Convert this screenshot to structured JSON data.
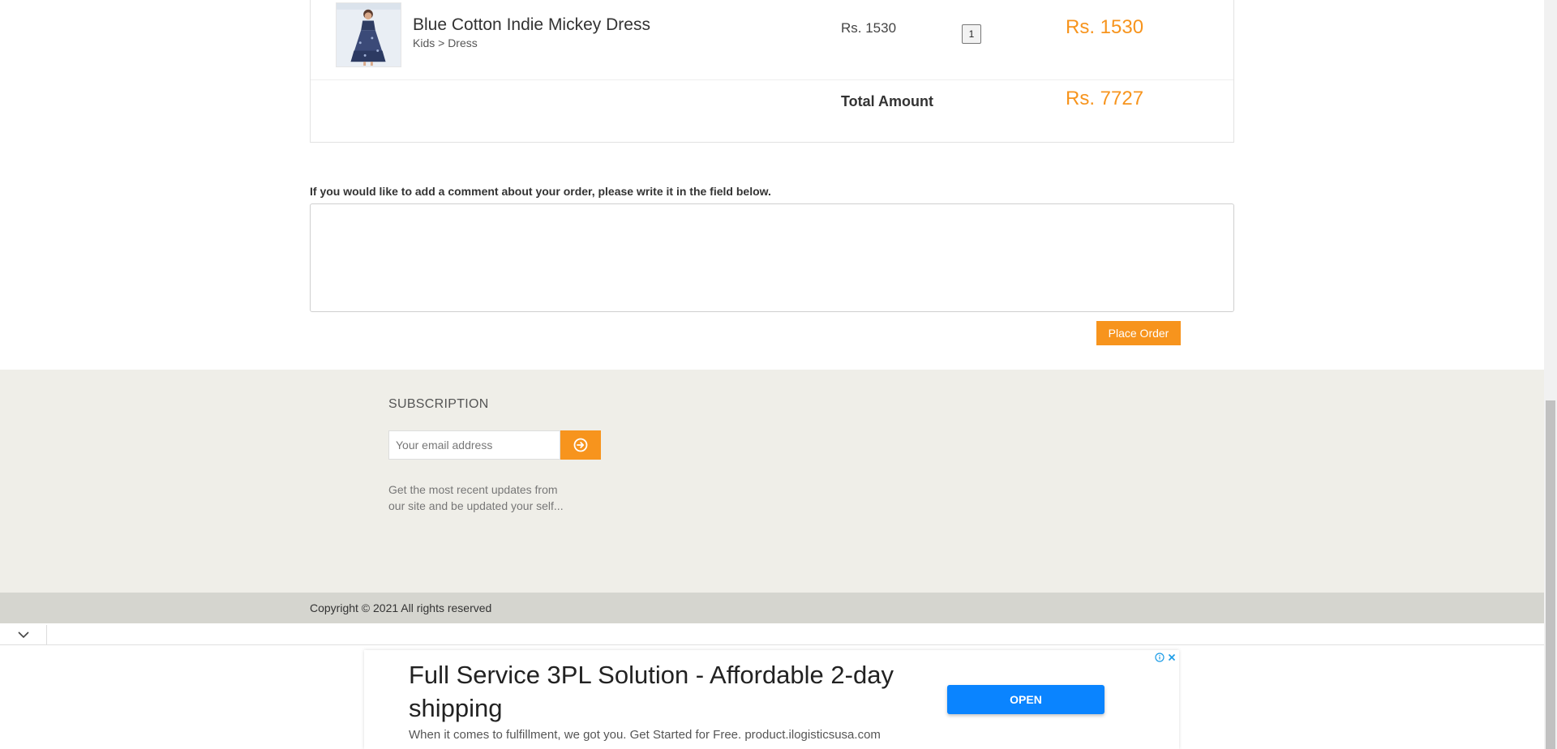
{
  "cart": {
    "item": {
      "name": "Blue Cotton Indie Mickey Dress",
      "category": "Kids > Dress",
      "unit_price": "Rs. 1530",
      "quantity": "1",
      "line_total": "Rs. 1530"
    },
    "total_label": "Total Amount",
    "total_value": "Rs. 7727"
  },
  "comment": {
    "label": "If you would like to add a comment about your order, please write it in the field below.",
    "value": "",
    "place_order_label": "Place Order"
  },
  "footer": {
    "subscription_title": "SUBSCRIPTION",
    "email_placeholder": "Your email address",
    "subscription_text": "Get the most recent updates from our site and be updated your self...",
    "copyright": "Copyright © 2021 All rights reserved"
  },
  "ad": {
    "headline": "Full Service 3PL Solution - Affordable 2-day shipping",
    "description": "When it comes to fulfillment, we got you. Get Started for Free. product.ilogisticsusa.com",
    "cta_label": "OPEN"
  },
  "colors": {
    "accent": "#f7941d",
    "footer_bg": "#efeee8",
    "copyright_bg": "#d5d5cf",
    "ad_button": "#0a84ff"
  },
  "icons": {
    "subscribe": "arrow-circle-right-icon",
    "ad_info": "info-icon",
    "ad_close": "close-icon",
    "ad_collapse": "chevron-down-icon"
  }
}
